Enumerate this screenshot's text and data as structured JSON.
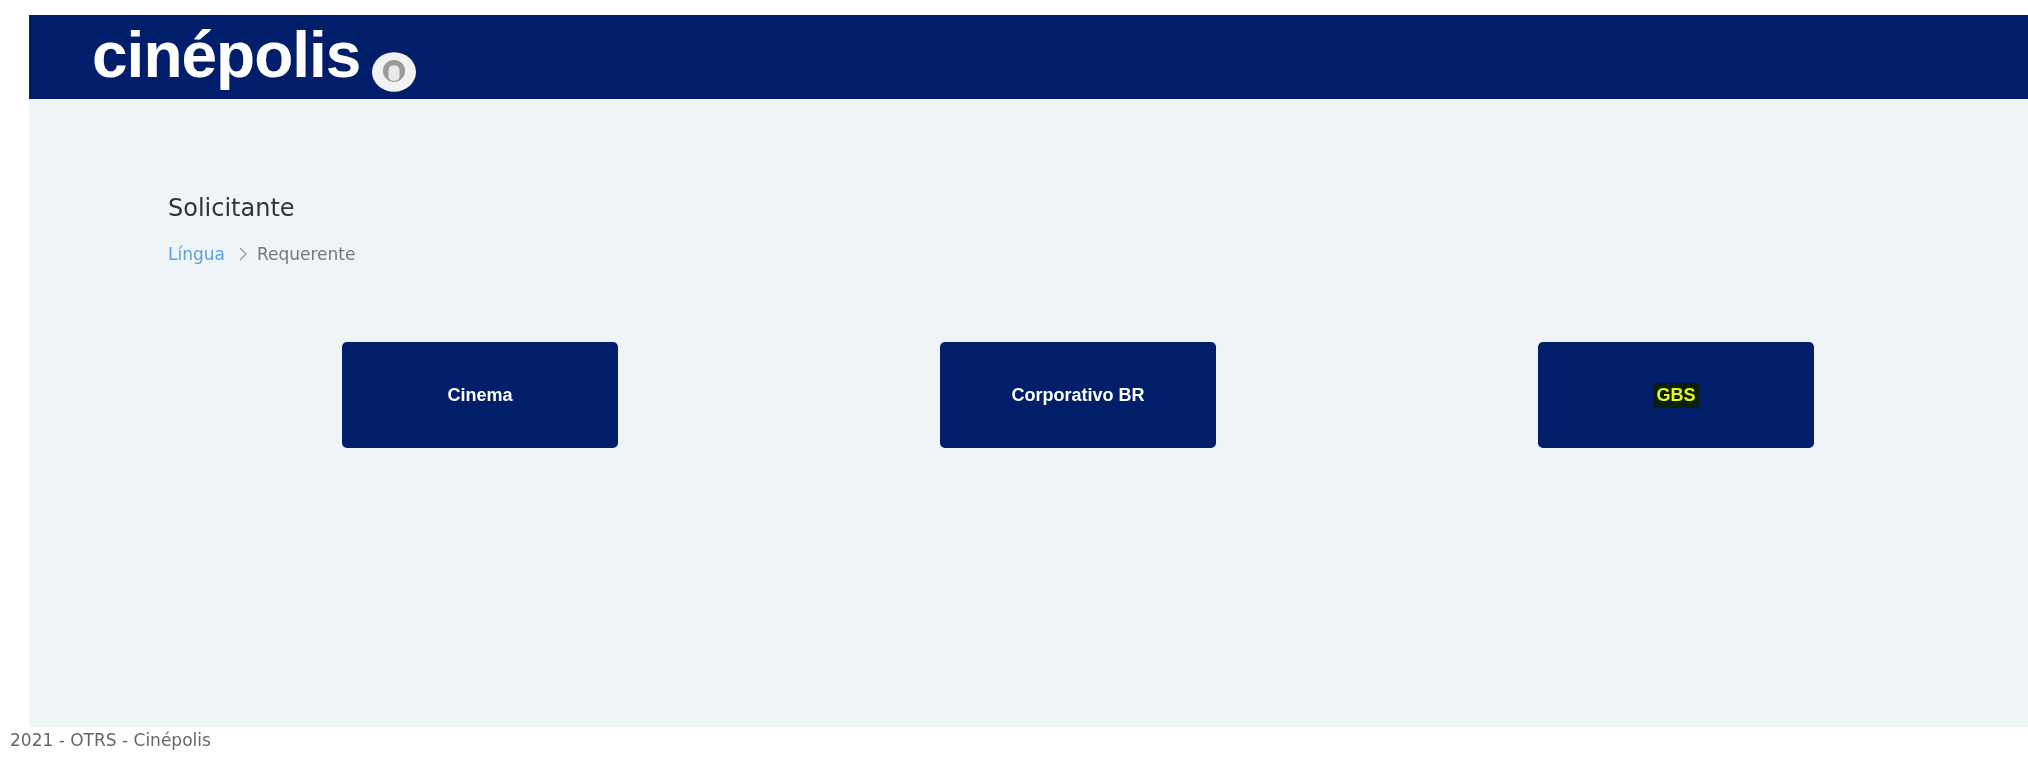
{
  "header": {
    "logo": "cinépolis"
  },
  "page": {
    "title": "Solicitante",
    "breadcrumb": [
      {
        "label": "Língua",
        "kind": "link"
      },
      {
        "label": "Requerente",
        "kind": "current"
      }
    ]
  },
  "options": [
    {
      "label": "Cinema",
      "highlighted": false
    },
    {
      "label": "Corporativo BR",
      "highlighted": false
    },
    {
      "label": "GBS",
      "highlighted": true
    }
  ],
  "footer": "2021 - OTRS - Cinépolis"
}
